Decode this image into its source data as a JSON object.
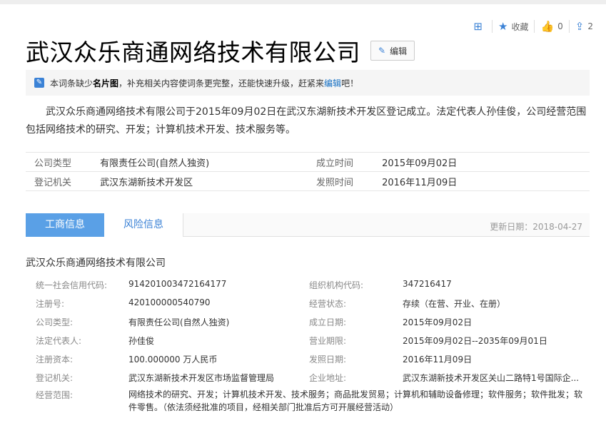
{
  "header": {
    "actions": [
      {
        "icon": "add-icon",
        "label": ""
      },
      {
        "icon": "star-icon",
        "label": "收藏"
      },
      {
        "icon": "thumb-up-icon",
        "label": "0"
      },
      {
        "icon": "share-icon",
        "label": "2"
      }
    ]
  },
  "title": "武汉众乐商通网络技术有限公司",
  "edit_label": "编辑",
  "notice": {
    "pre": "本词条缺少",
    "bold": "名片图",
    "mid": "，补充相关内容使词条更完整，还能快速升级，赶紧来",
    "link": "编辑",
    "post": "吧！"
  },
  "summary": "武汉众乐商通网络技术有限公司于2015年09月02日在武汉东湖新技术开发区登记成立。法定代表人孙佳俊，公司经营范围包括网络技术的研究、开发；计算机技术开发、技术服务等。",
  "basic_info": [
    {
      "k1": "公司类型",
      "v1": "有限责任公司(自然人独资)",
      "k2": "成立时间",
      "v2": "2015年09月02日"
    },
    {
      "k1": "登记机关",
      "v1": "武汉东湖新技术开发区",
      "k2": "发照时间",
      "v2": "2016年11月09日"
    }
  ],
  "tabs": {
    "active": "工商信息",
    "inactive": "风险信息",
    "update": "更新日期：2018-04-27"
  },
  "company_name": "武汉众乐商通网络技术有限公司",
  "detail": [
    {
      "k1": "统一社会信用代码:",
      "v1": "914201003472164177",
      "k2": "组织机构代码:",
      "v2": "347216417"
    },
    {
      "k1": "注册号:",
      "v1": "420100000540790",
      "k2": "经营状态:",
      "v2": "存续（在营、开业、在册）"
    },
    {
      "k1": "公司类型:",
      "v1": "有限责任公司(自然人独资)",
      "k2": "成立日期:",
      "v2": "2015年09月02日"
    },
    {
      "k1": "法定代表人:",
      "v1": "孙佳俊",
      "k2": "营业期限:",
      "v2": "2015年09月02日--2035年09月01日"
    },
    {
      "k1": "注册资本:",
      "v1": "100.000000 万人民币",
      "k2": "发照日期:",
      "v2": "2016年11月09日"
    },
    {
      "k1": "登记机关:",
      "v1": "武汉东湖新技术开发区市场监督管理局",
      "k2": "企业地址:",
      "v2": "武汉东湖新技术开发区关山二路特1号国际企..."
    }
  ],
  "scope": {
    "k": "经营范围:",
    "v": "网络技术的研究、开发；计算机技术开发、技术服务；商品批发贸易；计算机和辅助设备修理；软件服务；软件批发；软件零售。（依法须经批准的项目，经相关部门批准后方可开展经营活动）"
  }
}
